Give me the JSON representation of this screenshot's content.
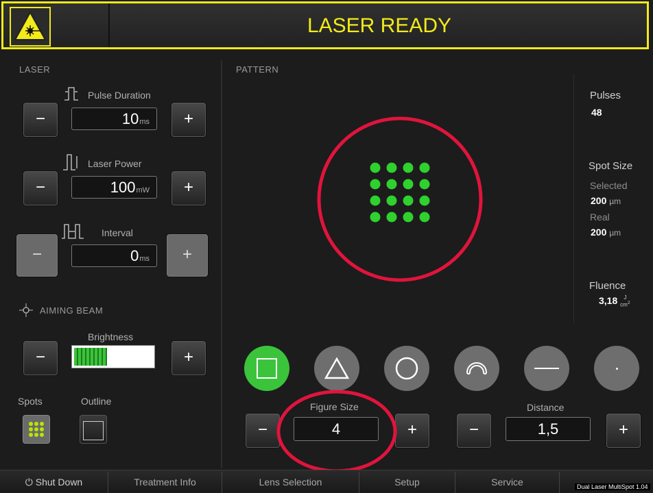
{
  "header": {
    "title": "LASER READY"
  },
  "laser": {
    "section_label": "LASER",
    "pulse_duration": {
      "label": "Pulse Duration",
      "value": "10",
      "unit": "ms"
    },
    "laser_power": {
      "label": "Laser Power",
      "value": "100",
      "unit": "mW"
    },
    "interval": {
      "label": "Interval",
      "value": "0",
      "unit": "ms"
    },
    "minus": "−",
    "plus": "+"
  },
  "aiming": {
    "section_label": "AIMING BEAM",
    "brightness_label": "Brightness",
    "brightness_level": 0.42,
    "spots_label": "Spots",
    "outline_label": "Outline"
  },
  "pattern": {
    "section_label": "PATTERN",
    "grid_rows": 4,
    "grid_cols": 4,
    "dot_color": "#2ed12e",
    "highlight_color": "#e0143c",
    "figure_size": {
      "label": "Figure Size",
      "value": "4"
    },
    "distance": {
      "label": "Distance",
      "value": "1,5"
    }
  },
  "info": {
    "pulses_label": "Pulses",
    "pulses_value": "48",
    "spot_size_label": "Spot Size",
    "selected_label": "Selected",
    "selected_value": "200",
    "selected_unit": "µm",
    "real_label": "Real",
    "real_value": "200",
    "real_unit": "µm",
    "fluence_label": "Fluence",
    "fluence_value": "3,18",
    "fluence_unit_top": "J",
    "fluence_unit_bottom": "cm",
    "fluence_unit_exp": "2"
  },
  "bottom_bar": {
    "shut_down": "Shut Down",
    "treatment_info": "Treatment Info",
    "lens_selection": "Lens Selection",
    "setup": "Setup",
    "service": "Service",
    "version": "Dual Laser MultiSpot 1.04"
  },
  "colors": {
    "accent_yellow": "#f2ea1a",
    "selected_green": "#3bc43b"
  }
}
